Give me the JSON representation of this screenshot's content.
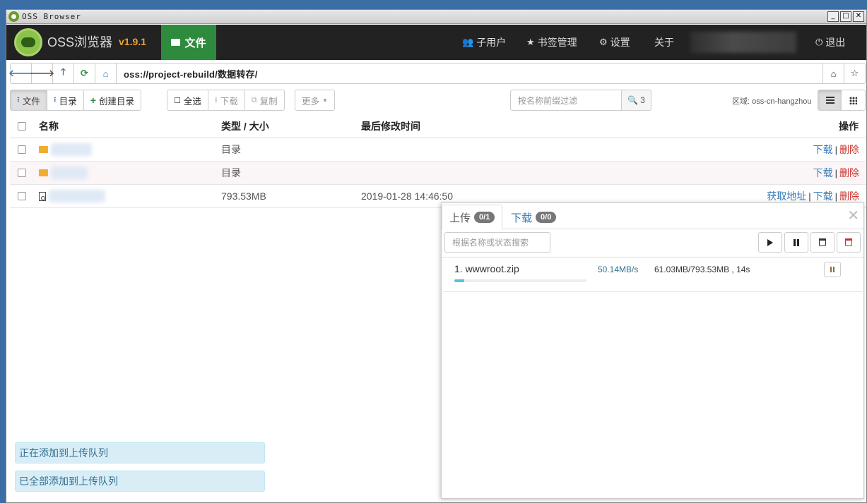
{
  "window": {
    "title": "OSS Browser"
  },
  "navbar": {
    "brand": "OSS浏览器",
    "version": "v1.9.1",
    "files_tab": "文件",
    "subusers": "子用户",
    "bookmarks": "书签管理",
    "settings": "设置",
    "about": "关于",
    "logout": "退出"
  },
  "address": {
    "path": "oss://project-rebuild/数据转存/"
  },
  "toolbar": {
    "upload_file": "文件",
    "upload_dir": "目录",
    "create_dir": "创建目录",
    "select_all": "全选",
    "download": "下载",
    "copy": "复制",
    "more": "更多",
    "filter_placeholder": "按名称前缀过滤",
    "count": "3",
    "region": "区域: oss-cn-hangzhou"
  },
  "table": {
    "headers": {
      "name": "名称",
      "type_size": "类型 / 大小",
      "modified": "最后修改时间",
      "actions": "操作"
    },
    "rows": [
      {
        "type": "目录",
        "modified": "",
        "get_url": "",
        "download": "下载",
        "delete": "删除"
      },
      {
        "type": "目录",
        "modified": "",
        "get_url": "",
        "download": "下载",
        "delete": "删除"
      },
      {
        "type": "793.53MB",
        "modified": "2019-01-28 14:46:50",
        "get_url": "获取地址",
        "download": "下载",
        "delete": "删除"
      }
    ]
  },
  "toasts": {
    "adding": "正在添加到上传队列",
    "added": "已全部添加到上传队列"
  },
  "transfer": {
    "upload_tab": "上传",
    "upload_badge": "0/1",
    "download_tab": "下载",
    "download_badge": "0/0",
    "search_placeholder": "根据名称或状态搜索",
    "jobs": [
      {
        "name": "1. wwwroot.zip",
        "speed": "50.14MB/s",
        "progress": "61.03MB/793.53MB , 14s",
        "fraction": 0.077
      }
    ]
  }
}
